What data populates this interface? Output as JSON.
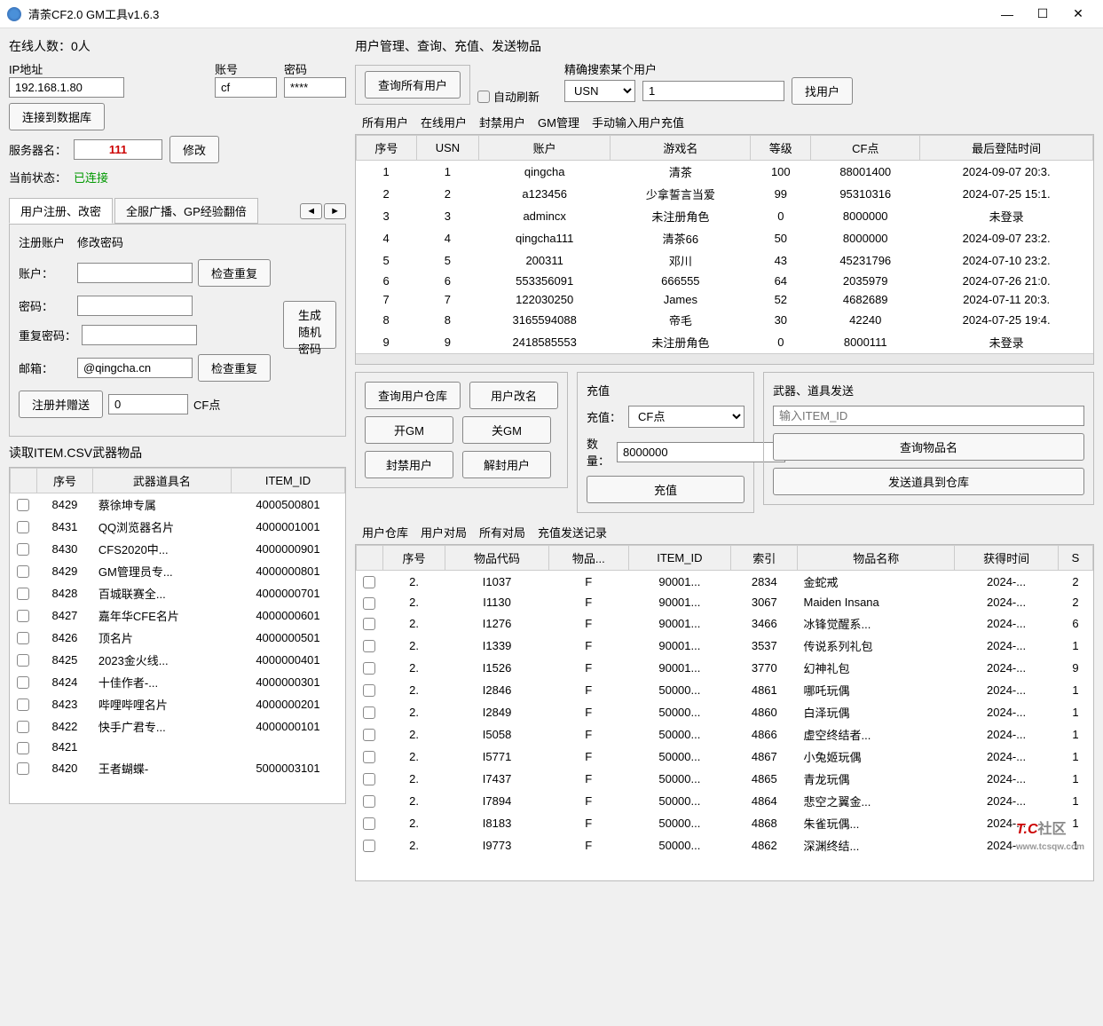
{
  "window": {
    "title": "清荼CF2.0 GM工具v1.6.3"
  },
  "conn": {
    "online_label": "在线人数：0人",
    "ip_label": "IP地址",
    "ip": "192.168.1.80",
    "acc_label": "账号",
    "acc": "cf",
    "pwd_label": "密码",
    "pwd": "****",
    "connect_btn": "连接到数据库",
    "server_label": "服务器名：",
    "server": "111",
    "modify_btn": "修改",
    "status_label": "当前状态：",
    "status": "已连接"
  },
  "reg_tabs": {
    "t1": "用户注册、改密",
    "t2": "全服广播、GP经验翻倍"
  },
  "reg": {
    "tab1": "注册账户",
    "tab2": "修改密码",
    "acc_label": "账户：",
    "check_dup": "检查重复",
    "pwd_label": "密码：",
    "pwd2_label": "重复密码：",
    "gen_pwd": "生成随机密码",
    "email_label": "邮箱：",
    "email": "@qingcha.cn",
    "reg_btn": "注册并赠送",
    "cf_val": "0",
    "cf_label": "CF点"
  },
  "itemcsv": {
    "title": "读取ITEM.CSV武器物品",
    "headers": [
      "序号",
      "武器道具名",
      "ITEM_ID"
    ],
    "rows": [
      [
        "8429",
        "蔡徐坤专属",
        "4000500801"
      ],
      [
        "8431",
        "QQ浏览器名片",
        "4000001001"
      ],
      [
        "8430",
        "CFS2020中...",
        "4000000901"
      ],
      [
        "8429",
        "GM管理员专...",
        "4000000801"
      ],
      [
        "8428",
        "百城联赛全...",
        "4000000701"
      ],
      [
        "8427",
        "嘉年华CFE名片",
        "4000000601"
      ],
      [
        "8426",
        "顶名片",
        "4000000501"
      ],
      [
        "8425",
        "2023金火线...",
        "4000000401"
      ],
      [
        "8424",
        "十佳作者-...",
        "4000000301"
      ],
      [
        "8423",
        "哔哩哔哩名片",
        "4000000201"
      ],
      [
        "8422",
        "快手广君专...",
        "4000000101"
      ],
      [
        "8421",
        "",
        ""
      ],
      [
        "8420",
        "王者蝴蝶-",
        "5000003101"
      ]
    ]
  },
  "mgmt": {
    "title": "用户管理、查询、充值、发送物品",
    "query_all": "查询所有用户",
    "auto_refresh": "自动刷新",
    "search_label": "精确搜索某个用户",
    "search_type": "USN",
    "search_val": "1",
    "find_btn": "找用户"
  },
  "usertabs": [
    "所有用户",
    "在线用户",
    "封禁用户",
    "GM管理",
    "手动输入用户充值"
  ],
  "users": {
    "headers": [
      "序号",
      "USN",
      "账户",
      "游戏名",
      "等级",
      "CF点",
      "最后登陆时间"
    ],
    "rows": [
      [
        "1",
        "1",
        "qingcha",
        "清茶",
        "100",
        "88001400",
        "2024-09-07 20:3."
      ],
      [
        "2",
        "2",
        "a123456",
        "少拿誓言当爱",
        "99",
        "95310316",
        "2024-07-25 15:1."
      ],
      [
        "3",
        "3",
        "admincx",
        "未注册角色",
        "0",
        "8000000",
        "未登录"
      ],
      [
        "4",
        "4",
        "qingcha111",
        "清茶66",
        "50",
        "8000000",
        "2024-09-07 23:2."
      ],
      [
        "5",
        "5",
        "200311",
        "邓川",
        "43",
        "45231796",
        "2024-07-10 23:2."
      ],
      [
        "6",
        "6",
        "553356091",
        "666555",
        "64",
        "2035979",
        "2024-07-26 21:0."
      ],
      [
        "7",
        "7",
        "122030250",
        "James",
        "52",
        "4682689",
        "2024-07-11 20:3."
      ],
      [
        "8",
        "8",
        "3165594088",
        "帝毛",
        "30",
        "42240",
        "2024-07-25 19:4."
      ],
      [
        "9",
        "9",
        "2418585553",
        "未注册角色",
        "0",
        "8000111",
        "未登录"
      ]
    ]
  },
  "actions": {
    "query_wh": "查询用户仓库",
    "rename": "用户改名",
    "open_gm": "开GM",
    "close_gm": "关GM",
    "ban": "封禁用户",
    "unban": "解封用户",
    "recharge_title": "充值",
    "recharge_label": "充值：",
    "recharge_type": "CF点",
    "qty_label": "数量：",
    "qty": "8000000",
    "recharge_btn": "充值",
    "send_title": "武器、道具发送",
    "item_ph": "输入ITEM_ID",
    "query_item": "查询物品名",
    "send_item": "发送道具到仓库"
  },
  "whtabs": [
    "用户仓库",
    "用户对局",
    "所有对局",
    "充值发送记录"
  ],
  "warehouse": {
    "headers": [
      "序号",
      "物品代码",
      "物品...",
      "ITEM_ID",
      "索引",
      "物品名称",
      "获得时间",
      "S"
    ],
    "rows": [
      [
        "2.",
        "I1037",
        "F",
        "90001...",
        "2834",
        "金蛇戒",
        "2024-...",
        "2"
      ],
      [
        "2.",
        "I1130",
        "F",
        "90001...",
        "3067",
        "Maiden Insana",
        "2024-...",
        "2"
      ],
      [
        "2.",
        "I1276",
        "F",
        "90001...",
        "3466",
        "冰锋觉醒系...",
        "2024-...",
        "6"
      ],
      [
        "2.",
        "I1339",
        "F",
        "90001...",
        "3537",
        "传说系列礼包",
        "2024-...",
        "1"
      ],
      [
        "2.",
        "I1526",
        "F",
        "90001...",
        "3770",
        "幻神礼包",
        "2024-...",
        "9"
      ],
      [
        "2.",
        "I2846",
        "F",
        "50000...",
        "4861",
        "哪吒玩偶",
        "2024-...",
        "1"
      ],
      [
        "2.",
        "I2849",
        "F",
        "50000...",
        "4860",
        "白泽玩偶",
        "2024-...",
        "1"
      ],
      [
        "2.",
        "I5058",
        "F",
        "50000...",
        "4866",
        "虚空终结者...",
        "2024-...",
        "1"
      ],
      [
        "2.",
        "I5771",
        "F",
        "50000...",
        "4867",
        "小兔姬玩偶",
        "2024-...",
        "1"
      ],
      [
        "2.",
        "I7437",
        "F",
        "50000...",
        "4865",
        "青龙玩偶",
        "2024-...",
        "1"
      ],
      [
        "2.",
        "I7894",
        "F",
        "50000...",
        "4864",
        "悲空之翼金...",
        "2024-...",
        "1"
      ],
      [
        "2.",
        "I8183",
        "F",
        "50000...",
        "4868",
        "朱雀玩偶...",
        "2024-...",
        "1"
      ],
      [
        "2.",
        "I9773",
        "F",
        "50000...",
        "4862",
        "深渊终结...",
        "2024-...",
        "1"
      ]
    ]
  },
  "watermark": {
    "tc": "T.C",
    "txt": "社区",
    "url": "www.tcsqw.com"
  }
}
